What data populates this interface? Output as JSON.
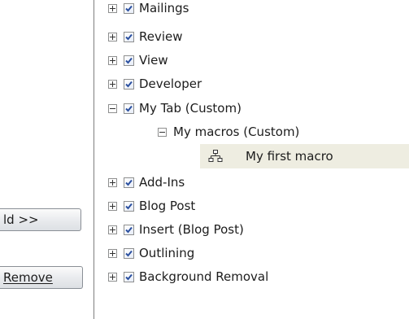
{
  "buttons": {
    "add_label": "ld >>",
    "remove_label": "Remove"
  },
  "tree": {
    "items": [
      {
        "label": "Mailings",
        "expanded": false,
        "checked": true
      },
      {
        "label": "Review",
        "expanded": false,
        "checked": true
      },
      {
        "label": "View",
        "expanded": false,
        "checked": true
      },
      {
        "label": "Developer",
        "expanded": false,
        "checked": true
      },
      {
        "label": "My Tab (Custom)",
        "expanded": true,
        "checked": true
      },
      {
        "label": "My macros (Custom)",
        "expanded": true
      },
      {
        "label": "My first macro",
        "selected": true,
        "icon": "macro-icon"
      },
      {
        "label": "Add-Ins",
        "expanded": false,
        "checked": true
      },
      {
        "label": "Blog Post",
        "expanded": false,
        "checked": true
      },
      {
        "label": "Insert (Blog Post)",
        "expanded": false,
        "checked": true
      },
      {
        "label": "Outlining",
        "expanded": false,
        "checked": true
      },
      {
        "label": "Background Removal",
        "expanded": false,
        "checked": true
      }
    ]
  },
  "colors": {
    "selection": "#eeede1",
    "checkmark": "#2a4f9f",
    "divider": "#7f7f7f"
  }
}
